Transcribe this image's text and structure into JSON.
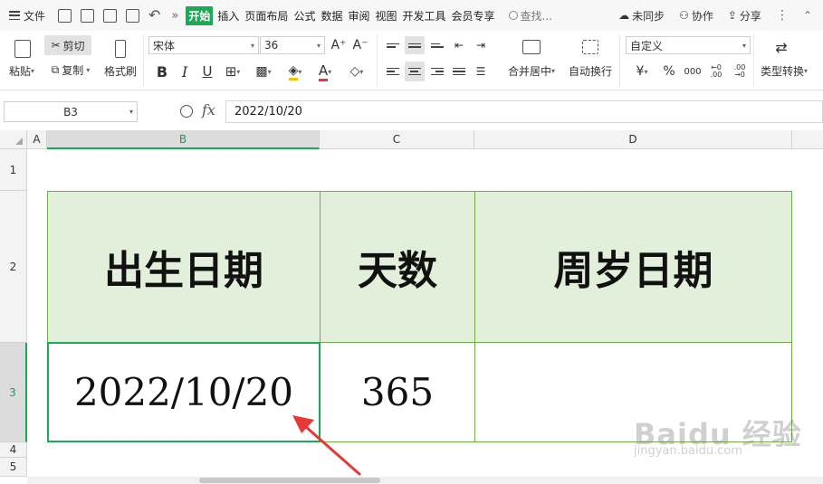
{
  "menu": {
    "file_label": "文件",
    "tabs": [
      "开始",
      "插入",
      "页面布局",
      "公式",
      "数据",
      "审阅",
      "视图",
      "开发工具",
      "会员专享"
    ],
    "search_placeholder": "查找...",
    "sync_label": "未同步",
    "collab_label": "协作",
    "share_label": "分享"
  },
  "ribbon": {
    "cut": "剪切",
    "paste": "粘贴",
    "copy": "复制",
    "format_painter": "格式刷",
    "font_name": "宋体",
    "font_size": "36",
    "bold": "B",
    "italic": "I",
    "underline": "U",
    "font_color": "A",
    "grow_font": "A⁺",
    "shrink_font": "A⁻",
    "merge_center": "合并居中",
    "wrap_text": "自动换行",
    "number_format": "自定义",
    "currency": "¥",
    "percent": "%",
    "thousands": "000",
    "inc_decimal": "←0 .00",
    "dec_decimal": ".00 →0",
    "type_convert": "类型转换"
  },
  "formula_bar": {
    "name_box": "B3",
    "fx": "fx",
    "value": "2022/10/20"
  },
  "grid": {
    "columns": [
      "A",
      "B",
      "C",
      "D"
    ],
    "rows": [
      "1",
      "2",
      "3",
      "4",
      "5"
    ],
    "headers": [
      "出生日期",
      "天数",
      "周岁日期"
    ],
    "row3": [
      "2022/10/20",
      "365",
      ""
    ]
  },
  "watermark": {
    "logo": "Baidu 经验",
    "url": "jingyan.baidu.com"
  },
  "colors": {
    "accent_green": "#1aaa55",
    "header_fill": "#e2efda",
    "table_border": "#70ad47",
    "arrow_red": "#e53935"
  }
}
